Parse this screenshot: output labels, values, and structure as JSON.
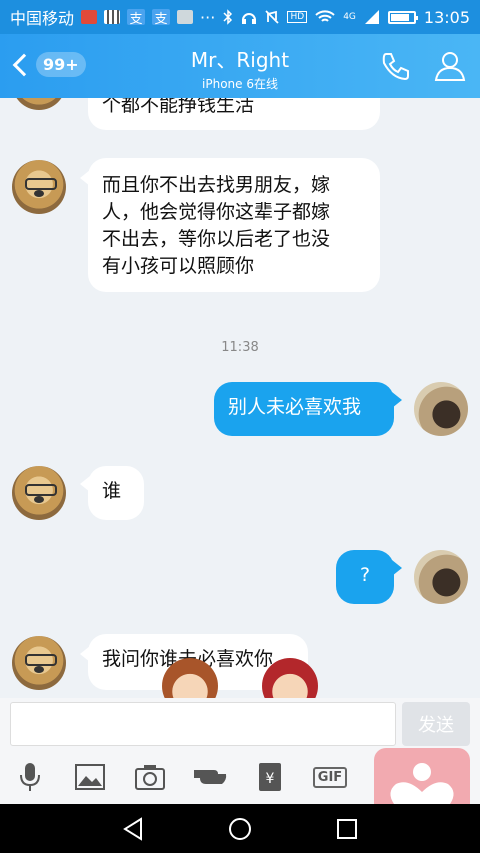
{
  "status_bar": {
    "carrier": "中国移动",
    "time": "13:05",
    "network": "4G",
    "battery_level": 0.8,
    "icons": [
      "red-app-icon",
      "qr-icon",
      "alipay-icon",
      "alipay-icon",
      "image-icon",
      "more-icon",
      "bluetooth-icon",
      "headphones-icon",
      "mute-icon",
      "hd-icon",
      "wifi-icon",
      "signal-icon",
      "battery-icon"
    ]
  },
  "header": {
    "unread_badge": "99+",
    "title": "Mr、Right",
    "subtitle": "iPhone 6在线"
  },
  "messages": [
    {
      "side": "in",
      "text": "个都不能挣钱生活"
    },
    {
      "side": "in",
      "lines": [
        "而且你不出去找男朋友，嫁",
        "人，他会觉得你这辈子都嫁",
        "不出去，等你以后老了也没",
        "有小孩可以照顾你"
      ]
    },
    {
      "side": "out",
      "text": "别人未必喜欢我"
    },
    {
      "side": "in",
      "text": "谁"
    },
    {
      "side": "out",
      "text": "?"
    },
    {
      "side": "in",
      "text": "我问你谁未必喜欢你"
    }
  ],
  "timestamp": "11:38",
  "input": {
    "placeholder": "",
    "send_label": "发送"
  },
  "toolbar": {
    "gif_label": "GIF"
  },
  "colors": {
    "accent": "#1aa3ee",
    "header": "#2b9df0",
    "float_button": "#f2aab0"
  }
}
